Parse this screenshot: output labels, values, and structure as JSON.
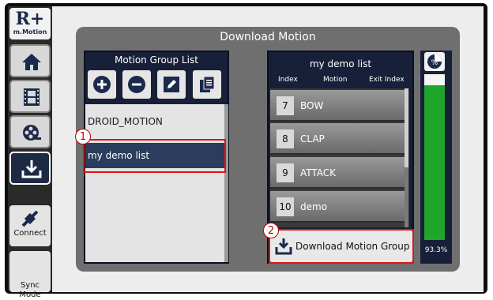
{
  "app": {
    "logo_text": "R+",
    "logo_subtext": "m.Motion"
  },
  "sidebar": {
    "nav": [
      {
        "icon": "home-icon",
        "active": false
      },
      {
        "icon": "film-icon",
        "active": false
      },
      {
        "icon": "film-reel-icon",
        "active": false
      },
      {
        "icon": "download-icon",
        "active": true
      }
    ],
    "connect_label": "Connect",
    "sync_mode_label": "Sync\nMode"
  },
  "panel": {
    "title": "Download Motion"
  },
  "group_list": {
    "title": "Motion Group List",
    "items": [
      {
        "label": "DROID_MOTION",
        "selected": false
      },
      {
        "label": "my demo list",
        "selected": true
      }
    ]
  },
  "motion_list": {
    "title": "my demo list",
    "columns": [
      "Index",
      "Motion",
      "Exit Index"
    ],
    "rows": [
      {
        "index": "7",
        "name": "BOW"
      },
      {
        "index": "8",
        "name": "CLAP"
      },
      {
        "index": "9",
        "name": "ATTACK"
      },
      {
        "index": "10",
        "name": "demo"
      }
    ]
  },
  "download_button": {
    "label": "Download Motion Group"
  },
  "gauge": {
    "percent_text": "93.3%",
    "fill_fraction": 0.933,
    "icon_label": "%"
  },
  "annotations": {
    "badge_1": "1",
    "badge_2": "2"
  },
  "colors": {
    "accent_red": "#e01515",
    "selected_bg": "#2b3d5c",
    "gauge_green": "#1fa62a"
  }
}
